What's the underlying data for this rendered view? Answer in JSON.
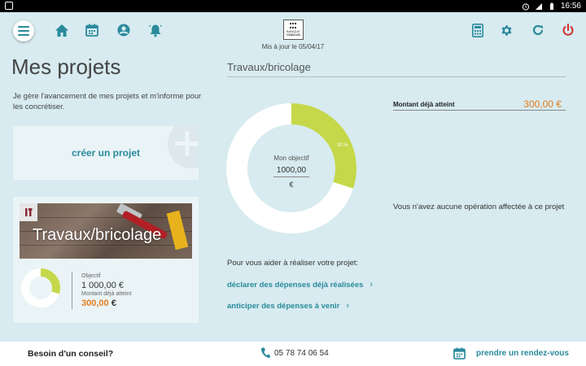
{
  "status_bar": {
    "time": "16:56"
  },
  "header": {
    "logo_text_line1": "BANQUE",
    "logo_text_line2": "CHALUS",
    "updated_text": "Mis à jour le 05/04/17"
  },
  "icons": {
    "menu": "menu-icon",
    "home": "home-icon",
    "calendar": "calendar-icon",
    "profile": "user-icon",
    "notifications": "bell-icon",
    "calculator": "calculator-icon",
    "settings": "gear-icon",
    "refresh": "refresh-icon",
    "power": "power-icon"
  },
  "colors": {
    "accent": "#2a8a9c",
    "green": "#c5d84a",
    "orange": "#e57b1d",
    "power": "#d32f2f"
  },
  "left": {
    "title": "Mes projets",
    "intro": "Je gère l'avancement de mes projets et m'informe pour les concrétiser.",
    "create_label": "créer un projet",
    "project": {
      "banner_title": "Travaux/bricolage",
      "objective_label": "Objectif",
      "objective_value": "1 000,00 €",
      "reached_label": "Montant déjà atteint",
      "reached_value": "300,00",
      "reached_currency": "€",
      "progress": 0.3
    }
  },
  "center": {
    "section_title": "Travaux/bricolage",
    "donut_label": "Mon objectif",
    "donut_value": "1000,00",
    "donut_currency": "€",
    "percent_label": "30 %",
    "progress": 0.3,
    "help_text": "Pour vous aider à réaliser votre projet:",
    "links": [
      {
        "label": "déclarer des dépenses déjà réalisées"
      },
      {
        "label": "anticiper des dépenses à venir"
      }
    ]
  },
  "right": {
    "reached_label": "Montant déjà atteint",
    "reached_value": "300,00 €",
    "no_operation": "Vous n'avez aucune opération affectée à ce projet"
  },
  "footer": {
    "advice": "Besoin d'un conseil?",
    "phone": "05 78 74 06 54",
    "appointment": "prendre un rendez-vous"
  }
}
